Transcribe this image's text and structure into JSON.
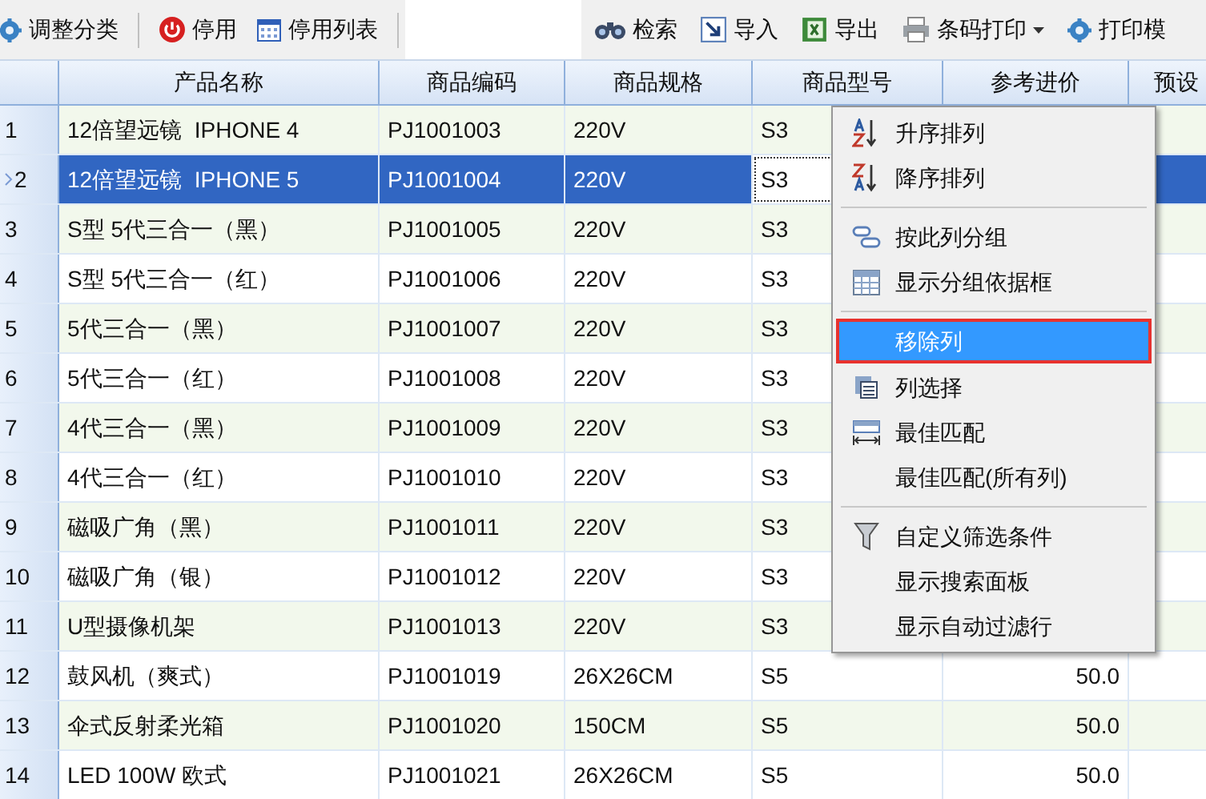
{
  "toolbar": {
    "left": [
      {
        "label": "调整分类",
        "dropdown": false
      },
      {
        "label": "停用",
        "dropdown": false
      },
      {
        "label": "停用列表",
        "dropdown": false
      }
    ],
    "right": [
      {
        "label": "检索",
        "dropdown": false
      },
      {
        "label": "导入",
        "dropdown": false
      },
      {
        "label": "导出",
        "dropdown": false
      },
      {
        "label": "条码打印",
        "dropdown": true
      },
      {
        "label": "打印模",
        "dropdown": false
      }
    ]
  },
  "table": {
    "columns": [
      "产品名称",
      "商品编码",
      "商品规格",
      "商品型号",
      "参考进价",
      "预设"
    ],
    "rows": [
      {
        "number": "1",
        "name": "12倍望远镜  IPHONE 4",
        "code": "PJ1001003",
        "spec": "220V",
        "model": "S3",
        "selected": false
      },
      {
        "number": "2",
        "name": "12倍望远镜  IPHONE 5",
        "code": "PJ1001004",
        "spec": "220V",
        "model": "S3",
        "selected": true
      },
      {
        "number": "3",
        "name": "S型 5代三合一（黑）",
        "code": "PJ1001005",
        "spec": "220V",
        "model": "S3",
        "selected": false
      },
      {
        "number": "4",
        "name": "S型 5代三合一（红）",
        "code": "PJ1001006",
        "spec": "220V",
        "model": "S3",
        "selected": false
      },
      {
        "number": "5",
        "name": "5代三合一（黑）",
        "code": "PJ1001007",
        "spec": "220V",
        "model": "S3",
        "selected": false
      },
      {
        "number": "6",
        "name": "5代三合一（红）",
        "code": "PJ1001008",
        "spec": "220V",
        "model": "S3",
        "selected": false
      },
      {
        "number": "7",
        "name": "4代三合一（黑）",
        "code": "PJ1001009",
        "spec": "220V",
        "model": "S3",
        "selected": false
      },
      {
        "number": "8",
        "name": "4代三合一（红）",
        "code": "PJ1001010",
        "spec": "220V",
        "model": "S3",
        "selected": false
      },
      {
        "number": "9",
        "name": "磁吸广角（黑）",
        "code": "PJ1001011",
        "spec": "220V",
        "model": "S3",
        "selected": false
      },
      {
        "number": "10",
        "name": "磁吸广角（银）",
        "code": "PJ1001012",
        "spec": "220V",
        "model": "S3",
        "selected": false
      },
      {
        "number": "11",
        "name": "U型摄像机架",
        "code": "PJ1001013",
        "spec": "220V",
        "model": "S3",
        "selected": false
      },
      {
        "number": "12",
        "name": "鼓风机（爽式）",
        "code": "PJ1001019",
        "spec": "26X26CM",
        "model": "S5",
        "price": "50.0",
        "selected": false
      },
      {
        "number": "13",
        "name": "伞式反射柔光箱",
        "code": "PJ1001020",
        "spec": "150CM",
        "model": "S5",
        "price": "50.0",
        "selected": false
      },
      {
        "number": "14",
        "name": "LED 100W 欧式",
        "code": "PJ1001021",
        "spec": "26X26CM",
        "model": "S5",
        "price": "50.0",
        "selected": false
      }
    ]
  },
  "context_menu": {
    "groups": [
      [
        {
          "label": "升序排列",
          "selected": false
        },
        {
          "label": "降序排列",
          "selected": false
        }
      ],
      [
        {
          "label": "按此列分组",
          "selected": false
        },
        {
          "label": "显示分组依据框",
          "selected": false
        }
      ],
      [
        {
          "label": "移除列",
          "selected": true
        },
        {
          "label": "列选择",
          "selected": false
        },
        {
          "label": "最佳匹配",
          "selected": false
        },
        {
          "label": "最佳匹配(所有列)",
          "selected": false
        }
      ],
      [
        {
          "label": "自定义筛选条件",
          "selected": false
        },
        {
          "label": "显示搜索面板",
          "selected": false
        },
        {
          "label": "显示自动过滤行",
          "selected": false
        }
      ]
    ]
  }
}
